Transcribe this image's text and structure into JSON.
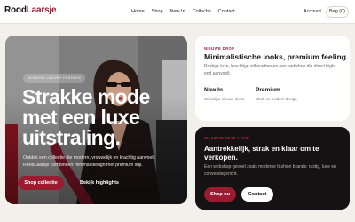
{
  "header": {
    "logo_part1": "Rood",
    "logo_part2": "Laarsje",
    "nav": [
      "Home",
      "Shop",
      "New In",
      "Collectie",
      "Contact"
    ],
    "account": "Account",
    "bag": "Bag (0)"
  },
  "hero": {
    "badge": "MODERN LUXURY FASHION",
    "title": "Strakke mode met een luxe uitstraling.",
    "text": "Ontdek een collectie die modern, vrouwelijk en krachtig aanvoelt. RoodLaarsje combineert minimal design met premium stijl.",
    "primary_button": "Shop collectie",
    "secondary_button": "Bekijk highlights"
  },
  "feature_card": {
    "eyebrow": "NIEUWE DROP",
    "title": "Minimalistische looks, premium feeling.",
    "text": "Rustige luxe, krachtige silhouetten en een webshop die direct high-end aanvoelt.",
    "items": [
      {
        "title": "New In",
        "subtitle": "Wekelijks nieuwe items"
      },
      {
        "title": "Premium",
        "subtitle": "Strak en modern design"
      }
    ]
  },
  "dark_card": {
    "eyebrow": "WAAROM DEZE LOOK",
    "title": "Aantrekkelijk, strak en klaar om te verkopen.",
    "text": "Een webshop-gevoel zoals moderne fashion brands: rustig, luxe en conversiegericht.",
    "shop_button": "Shop nu",
    "contact_button": "Contact"
  },
  "colors": {
    "accent": "#9b1b30",
    "dark": "#141212",
    "background": "#f3f0ec"
  }
}
